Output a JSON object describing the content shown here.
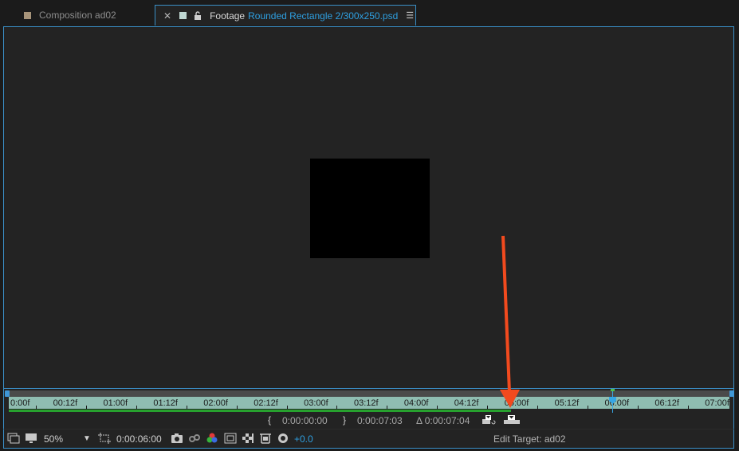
{
  "tabs": {
    "composition": {
      "label": "Composition ad02"
    },
    "footage": {
      "label": "Footage",
      "filename": "Rounded Rectangle 2/300x250.psd"
    }
  },
  "ruler": {
    "ticks": [
      "0:00f",
      "00:12f",
      "01:00f",
      "01:12f",
      "02:00f",
      "02:12f",
      "03:00f",
      "03:12f",
      "04:00f",
      "04:12f",
      "05:00f",
      "05:12f",
      "06:00f",
      "06:12f",
      "07:00f"
    ]
  },
  "timeline": {
    "in_point": "0:00:00:00",
    "out_point": "0:00:07:03",
    "duration": "Δ 0:00:07:04"
  },
  "bottom": {
    "zoom": "50%",
    "current_time": "0:00:06:00",
    "exposure": "+0.0",
    "edit_target": "Edit Target: ad02"
  },
  "colors": {
    "accent_blue": "#3a8fc7",
    "ruler_fill": "#8fbdb1",
    "work_area_green": "#27a12e",
    "annotation_arrow": "#f24a1e"
  }
}
